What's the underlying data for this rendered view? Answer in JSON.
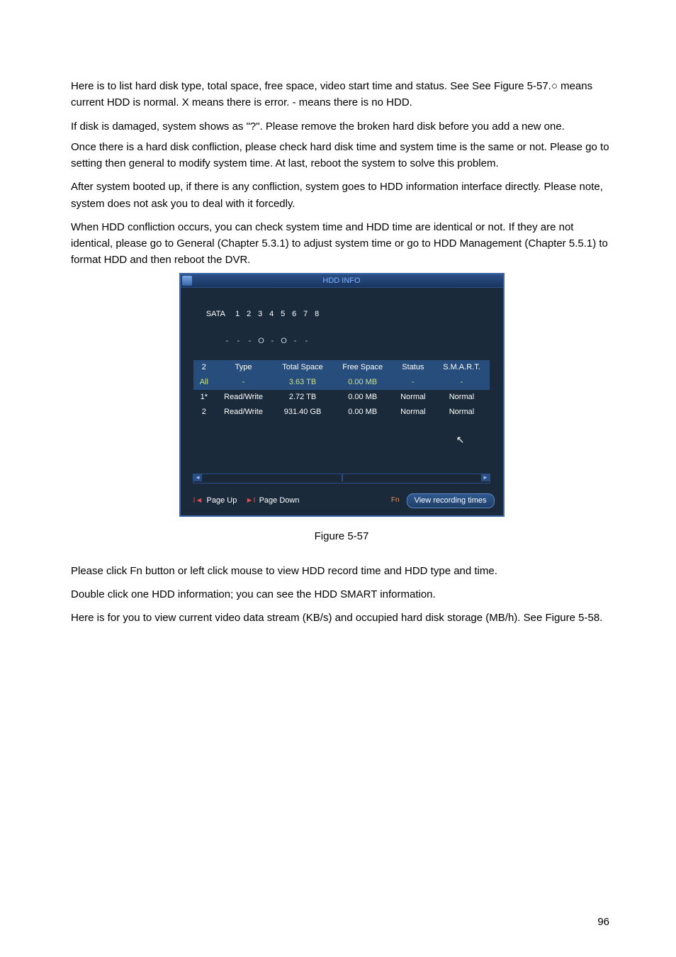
{
  "body": {
    "p1": "Here is to list hard disk type, total space, free space, video start time and status. See  See Figure 5-57.○ means current HDD is normal. X means there is error. - means there is no HDD.",
    "p2": "If disk is damaged, system shows as \"?\". Please remove the broken hard disk before you add a new one.",
    "p3": "Once there is a hard disk confliction, please check hard disk time and system time is the same or not. Please go to setting then general to modify system time.  At last, reboot the system to solve this problem.",
    "p4": "After system booted up, if there is any confliction, system goes to HDD information interface directly. Please note, system does not ask you to deal with it forcedly.",
    "p5": "When HDD confliction occurs, you can check system time and HDD time are identical or not. If they are not identical, please go to General (Chapter 5.3.1) to adjust system time or go to HDD Management (Chapter 5.5.1) to format HDD and then reboot the DVR.",
    "caption": "Figure 5-57",
    "p6": "Please click Fn button or left click mouse to view HDD record time and HDD type and time.",
    "p7": "Double click one HDD information; you can see the HDD SMART information.",
    "p8": "Here is for you to view current video data stream (KB/s) and occupied hard disk storage (MB/h). See Figure 5-58.",
    "page_number": "96"
  },
  "panel": {
    "title": "HDD INFO",
    "sata_label": "SATA",
    "sata_numbers": [
      "1",
      "2",
      "3",
      "4",
      "5",
      "6",
      "7",
      "8"
    ],
    "sata_dots": [
      "-",
      "-",
      "-",
      "O",
      "-",
      "O",
      "-",
      "-"
    ],
    "columns": {
      "c0": "2",
      "c1": "Type",
      "c2": "Total Space",
      "c3": "Free Space",
      "c4": "Status",
      "c5": "S.M.A.R.T."
    },
    "rows": [
      {
        "c0": "All",
        "c1": "-",
        "c2": "3.63 TB",
        "c3": "0.00 MB",
        "c4": "-",
        "c5": "-",
        "sel": true
      },
      {
        "c0": "1*",
        "c1": "Read/Write",
        "c2": "2.72 TB",
        "c3": "0.00 MB",
        "c4": "Normal",
        "c5": "Normal",
        "sel": false
      },
      {
        "c0": "2",
        "c1": "Read/Write",
        "c2": "931.40 GB",
        "c3": "0.00 MB",
        "c4": "Normal",
        "c5": "Normal",
        "sel": false
      }
    ],
    "footer": {
      "page_up_mark": "I◄",
      "page_up": "Page Up",
      "page_down_mark": "►I",
      "page_down": "Page Down",
      "fn": "Fn",
      "button": "View recording times"
    },
    "scroll": {
      "left": "◄",
      "right": "►"
    },
    "cursor": "↖"
  }
}
